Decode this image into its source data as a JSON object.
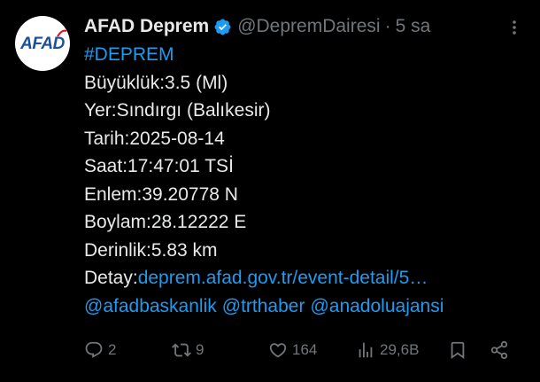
{
  "author": {
    "avatar_text": "AFAD",
    "display_name": "AFAD Deprem",
    "handle": "@DepremDairesi",
    "separator": "·",
    "time": "5 sa"
  },
  "tweet": {
    "hashtag": "#DEPREM",
    "lines": [
      "Büyüklük:3.5 (Ml)",
      "Yer:Sındırgı (Balıkesir)",
      "Tarih:2025-08-14",
      "Saat:17:47:01 TSİ",
      "Enlem:39.20778 N",
      "Boylam:28.12222 E",
      "Derinlik:5.83 km"
    ],
    "detail_label": "Detay:",
    "detail_link": "deprem.afad.gov.tr/event-detail/5…",
    "mentions": [
      "@afadbaskanlik",
      "@trthaber",
      "@anadoluajansi"
    ]
  },
  "actions": {
    "replies": "2",
    "reposts": "9",
    "likes": "164",
    "views": "29,6B"
  },
  "colors": {
    "background": "#000000",
    "text": "#e7e9ea",
    "secondary": "#71767b",
    "link": "#1d9bf0",
    "verified": "#1d9bf0",
    "logo": "#1e4f9c"
  },
  "icons": {
    "verified": "verified-badge-icon",
    "more": "more-vertical-icon",
    "reply": "reply-icon",
    "repost": "repost-icon",
    "like": "heart-icon",
    "views": "views-chart-icon",
    "bookmark": "bookmark-icon",
    "share": "share-icon"
  }
}
